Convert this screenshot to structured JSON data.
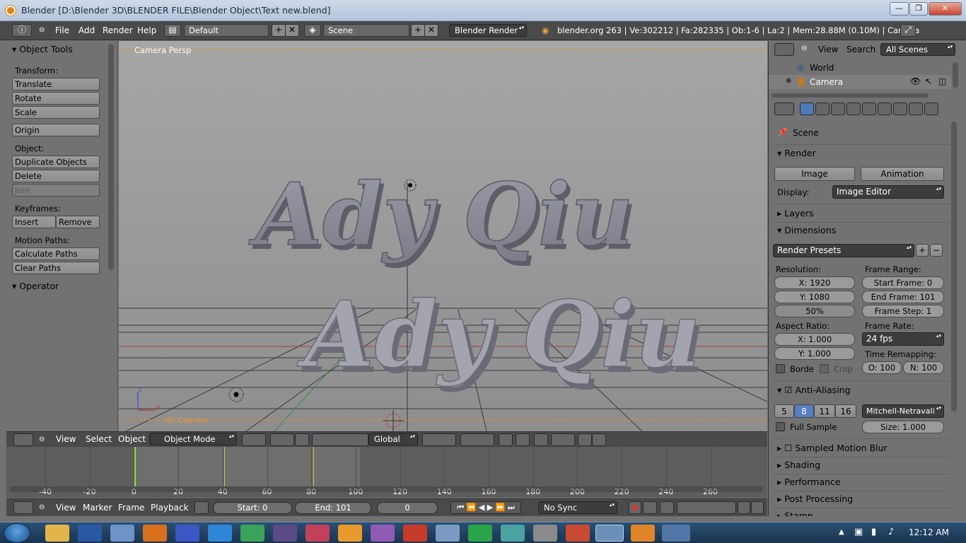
{
  "window": {
    "title": "Blender  [D:\\Blender 3D\\BLENDER FILE\\Blender Object\\Text new.blend]",
    "min": "—",
    "max": "❐",
    "close": "✕"
  },
  "topbar": {
    "menus": [
      "File",
      "Add",
      "Render",
      "Help"
    ],
    "layout": "Default",
    "scene": "Scene",
    "engine": "Blender Render",
    "stats": "blender.org 263 | Ve:302212 | Fa:282335 | Ob:1-6 | La:2 | Mem:28.88M (0.10M) | Camera"
  },
  "tools": {
    "header": "Object Tools",
    "transform_label": "Transform:",
    "translate": "Translate",
    "rotate": "Rotate",
    "scale": "Scale",
    "origin": "Origin",
    "object_label": "Object:",
    "duplicate": "Duplicate Objects",
    "delete": "Delete",
    "join": "Join",
    "keyframes_label": "Keyframes:",
    "insert": "Insert",
    "remove": "Remove",
    "motion_label": "Motion Paths:",
    "calc_paths": "Calculate Paths",
    "clear_paths": "Clear Paths",
    "operator": "Operator"
  },
  "viewport": {
    "label": "Camera Persp",
    "camera_name": "(0) Camera",
    "text_line1": "Ady Qiu",
    "text_line2": "Ady Qiu",
    "axis_x": "x",
    "axis_z": "z"
  },
  "vpheader": {
    "view": "View",
    "select": "Select",
    "object": "Object",
    "mode": "Object Mode",
    "orientation": "Global"
  },
  "timeline": {
    "ticks": [
      "-40",
      "-20",
      "0",
      "20",
      "40",
      "60",
      "80",
      "100",
      "120",
      "140",
      "160",
      "180",
      "200",
      "220",
      "240",
      "260"
    ],
    "view": "View",
    "marker": "Marker",
    "frame": "Frame",
    "playback": "Playback",
    "start": "Start: 0",
    "end": "End: 101",
    "current": "0",
    "sync": "No Sync"
  },
  "outliner": {
    "view": "View",
    "search": "Search",
    "scenes": "All Scenes",
    "world": "World",
    "camera": "Camera"
  },
  "props": {
    "context": "Scene",
    "render": "Render",
    "image_btn": "Image",
    "animation_btn": "Animation",
    "display_label": "Display:",
    "display_value": "Image Editor",
    "layers": "Layers",
    "dimensions": "Dimensions",
    "presets": "Render Presets",
    "resolution_label": "Resolution:",
    "res_x": "X: 1920",
    "res_y": "Y: 1080",
    "res_pct": "50%",
    "frame_range_label": "Frame Range:",
    "start_frame": "Start Frame: 0",
    "end_frame": "End Frame: 101",
    "frame_step": "Frame Step: 1",
    "aspect_label": "Aspect Ratio:",
    "aspect_x": "X: 1.000",
    "aspect_y": "Y: 1.000",
    "frame_rate_label": "Frame Rate:",
    "frame_rate": "24 fps",
    "time_remap_label": "Time Remapping:",
    "remap_old": "O: 100",
    "remap_new": "N: 100",
    "border": "Borde",
    "crop": "Crop",
    "aa": "Anti-Aliasing",
    "aa_samples": [
      "5",
      "8",
      "11",
      "16"
    ],
    "filter": "Mitchell-Netravali",
    "full_sample": "Full Sample",
    "size": "Size: 1.000",
    "motion_blur": "Sampled Motion Blur",
    "shading": "Shading",
    "performance": "Performance",
    "post": "Post Processing",
    "stamp": "Stamp"
  },
  "taskbar": {
    "time": "12:12 AM"
  }
}
